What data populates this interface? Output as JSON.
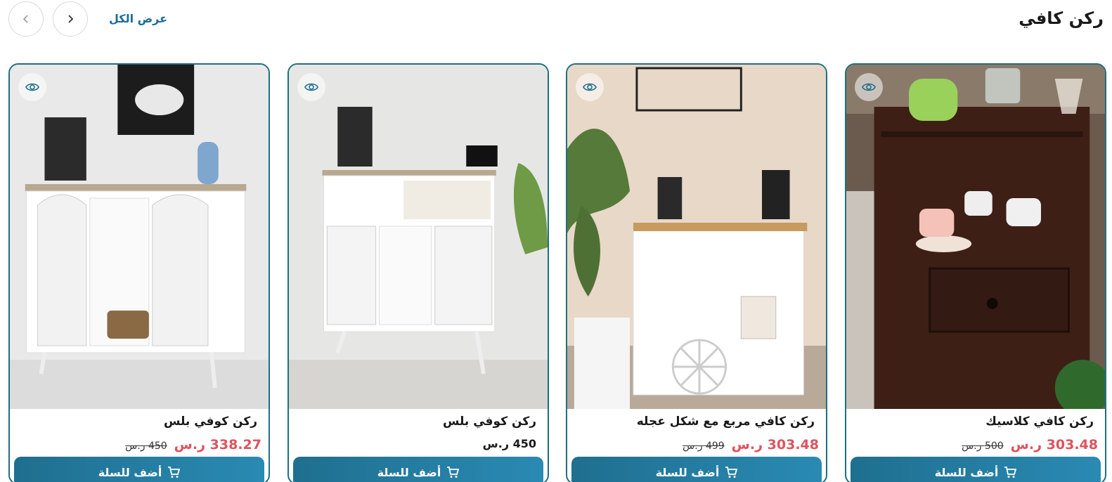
{
  "section": {
    "title": "ركن كافي",
    "view_all": "عرض الكل"
  },
  "nav": {
    "prev_icon": "chevron-left-icon",
    "next_icon": "chevron-right-icon"
  },
  "colors": {
    "accent": "#1f6f8f",
    "sale_price": "#e0525c",
    "card_border": "#1f6f7f"
  },
  "products": [
    {
      "name": "ركن كافي كلاسيك",
      "price": "303.48 ر.س",
      "old_price": "500 ر.س",
      "add_label": "أضف للسلة",
      "image_alt": "dark wood side table with cups"
    },
    {
      "name": "ركن كافي مربع مع شكل عجله",
      "price": "303.48 ر.س",
      "old_price": "499 ر.س",
      "add_label": "أضف للسلة",
      "image_alt": "white coffee cart with wheel"
    },
    {
      "name": "ركن كوفي بلس",
      "price": "450 ر.س",
      "old_price": "",
      "add_label": "أضف للسلة",
      "image_alt": "white slatted coffee cabinet"
    },
    {
      "name": "ركن كوفي بلس",
      "price": "338.27 ر.س",
      "old_price": "450 ر.س",
      "add_label": "أضف للسلة",
      "image_alt": "white glass-door coffee cabinet"
    }
  ]
}
